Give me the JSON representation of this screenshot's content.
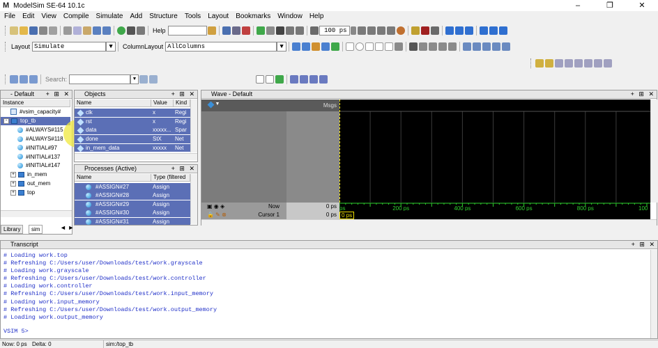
{
  "app": {
    "title": "ModelSim SE-64 10.1c",
    "logo": "M"
  },
  "window_buttons": [
    "–",
    "❐",
    "✕"
  ],
  "menu": [
    "File",
    "Edit",
    "View",
    "Compile",
    "Simulate",
    "Add",
    "Structure",
    "Tools",
    "Layout",
    "Bookmarks",
    "Window",
    "Help"
  ],
  "toolbar": {
    "help_label": "Help",
    "run_length": "100 ps",
    "layout_label": "Layout",
    "layout_value": "Simulate",
    "column_layout_label": "ColumnLayout",
    "column_layout_value": "AllColumns",
    "search_label": "Search:",
    "search_value": ""
  },
  "sim_pane": {
    "title": "- Default",
    "header": "Instance",
    "rows": [
      {
        "label": "#vsim_capacity#",
        "indent": 1,
        "kind": "cap"
      },
      {
        "label": "top_tb",
        "indent": 0,
        "kind": "module",
        "selected": true,
        "expanded": "-"
      },
      {
        "label": "#ALWAYS#115",
        "indent": 2,
        "kind": "ball"
      },
      {
        "label": "#ALWAYS#118",
        "indent": 2,
        "kind": "ball"
      },
      {
        "label": "#INITIAL#97",
        "indent": 2,
        "kind": "ball"
      },
      {
        "label": "#INITIAL#137",
        "indent": 2,
        "kind": "ball"
      },
      {
        "label": "#INITIAL#147",
        "indent": 2,
        "kind": "ball"
      },
      {
        "label": "in_mem",
        "indent": 1,
        "kind": "module",
        "expanded": "+"
      },
      {
        "label": "out_mem",
        "indent": 1,
        "kind": "module",
        "expanded": "+"
      },
      {
        "label": "top",
        "indent": 1,
        "kind": "module",
        "expanded": "+"
      }
    ],
    "tabs": [
      "Library",
      "sim"
    ]
  },
  "objects_pane": {
    "title": "Objects",
    "columns": [
      "Name",
      "Value",
      "Kind"
    ],
    "rows": [
      {
        "name": "clk",
        "value": "x",
        "kind": "Regi"
      },
      {
        "name": "rst",
        "value": "x",
        "kind": "Regi"
      },
      {
        "name": "data",
        "value": "xxxxx...",
        "kind": "Spar"
      },
      {
        "name": "done",
        "value": "StX",
        "kind": "Net"
      },
      {
        "name": "in_mem_data",
        "value": "xxxxx",
        "kind": "Net"
      }
    ]
  },
  "processes_pane": {
    "title": "Processes (Active)",
    "columns": [
      "Name",
      "Type (filtered"
    ],
    "rows": [
      {
        "name": "#ASSIGN#27",
        "type": "Assign"
      },
      {
        "name": "#ASSIGN#28",
        "type": "Assign"
      },
      {
        "name": "#ASSIGN#29",
        "type": "Assign"
      },
      {
        "name": "#ASSIGN#30",
        "type": "Assign"
      },
      {
        "name": "#ASSIGN#31",
        "type": "Assign"
      }
    ]
  },
  "wave_pane": {
    "title": "Wave - Default",
    "msgs_label": "Msgs",
    "now_label": "Now",
    "now_value": "0 ps",
    "cursor_label": "Cursor 1",
    "cursor_value": "0 ps",
    "cursor_marker": "0 ps",
    "ticks": [
      "ps",
      "200 ps",
      "400 ps",
      "600 ps",
      "800 ps",
      "100"
    ]
  },
  "transcript": {
    "title": "Transcript",
    "lines": [
      "# Loading work.top",
      "# Refreshing C:/Users/user/Downloads/test/work.grayscale",
      "# Loading work.grayscale",
      "# Refreshing C:/Users/user/Downloads/test/work.controller",
      "# Loading work.controller",
      "# Refreshing C:/Users/user/Downloads/test/work.input_memory",
      "# Loading work.input_memory",
      "# Refreshing C:/Users/user/Downloads/test/work.output_memory",
      "# Loading work.output_memory"
    ],
    "prompt": "VSIM 5>"
  },
  "status": {
    "now": "Now: 0 ps",
    "delta": "Delta: 0",
    "context": "sim:/top_tb"
  },
  "colors": {
    "selection": "#5b6fb6",
    "wave_bg": "#000000",
    "cursor": "#f0e000",
    "transcript_text": "#2030c8"
  }
}
